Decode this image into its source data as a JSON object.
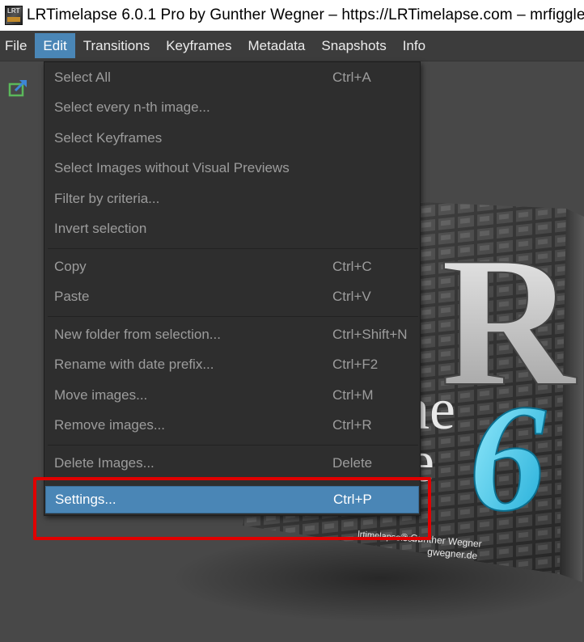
{
  "window": {
    "title": "LRTimelapse 6.0.1 Pro by Gunther Wegner – https://LRTimelapse.com – mrfiggle",
    "app_icon_text": "LRT"
  },
  "menubar": {
    "items": [
      {
        "label": "File"
      },
      {
        "label": "Edit"
      },
      {
        "label": "Transitions"
      },
      {
        "label": "Keyframes"
      },
      {
        "label": "Metadata"
      },
      {
        "label": "Snapshots"
      },
      {
        "label": "Info"
      }
    ],
    "active": "Edit"
  },
  "edit_menu": {
    "items": [
      {
        "label": "Select All",
        "shortcut": "Ctrl+A"
      },
      {
        "label": "Select every n-th image...",
        "shortcut": ""
      },
      {
        "label": "Select Keyframes",
        "shortcut": ""
      },
      {
        "label": "Select Images without Visual Previews",
        "shortcut": ""
      },
      {
        "label": "Filter by criteria...",
        "shortcut": ""
      },
      {
        "label": "Invert selection",
        "shortcut": ""
      },
      {
        "label": "Copy",
        "shortcut": "Ctrl+C"
      },
      {
        "label": "Paste",
        "shortcut": "Ctrl+V"
      },
      {
        "label": "New folder from selection...",
        "shortcut": "Ctrl+Shift+N"
      },
      {
        "label": "Rename with date prefix...",
        "shortcut": "Ctrl+F2"
      },
      {
        "label": "Move images...",
        "shortcut": "Ctrl+M"
      },
      {
        "label": "Remove images...",
        "shortcut": "Ctrl+R"
      },
      {
        "label": "Delete Images...",
        "shortcut": "Delete"
      },
      {
        "label": "Settings...",
        "shortcut": "Ctrl+P"
      }
    ],
    "selected_item": "Settings..."
  },
  "splash": {
    "big_letter": "R",
    "word_fragment_1": "ne",
    "word_fragment_2": "e",
    "version_digit": "6",
    "copyright": "© Gunther Wegner",
    "url_1": "lrtimelapse.com",
    "url_2": "gwegner.de"
  },
  "colors": {
    "accent": "#4a86b6",
    "highlight_box": "#e00000",
    "menu_bg": "#2e2e2e",
    "workspace_bg": "#484848"
  }
}
